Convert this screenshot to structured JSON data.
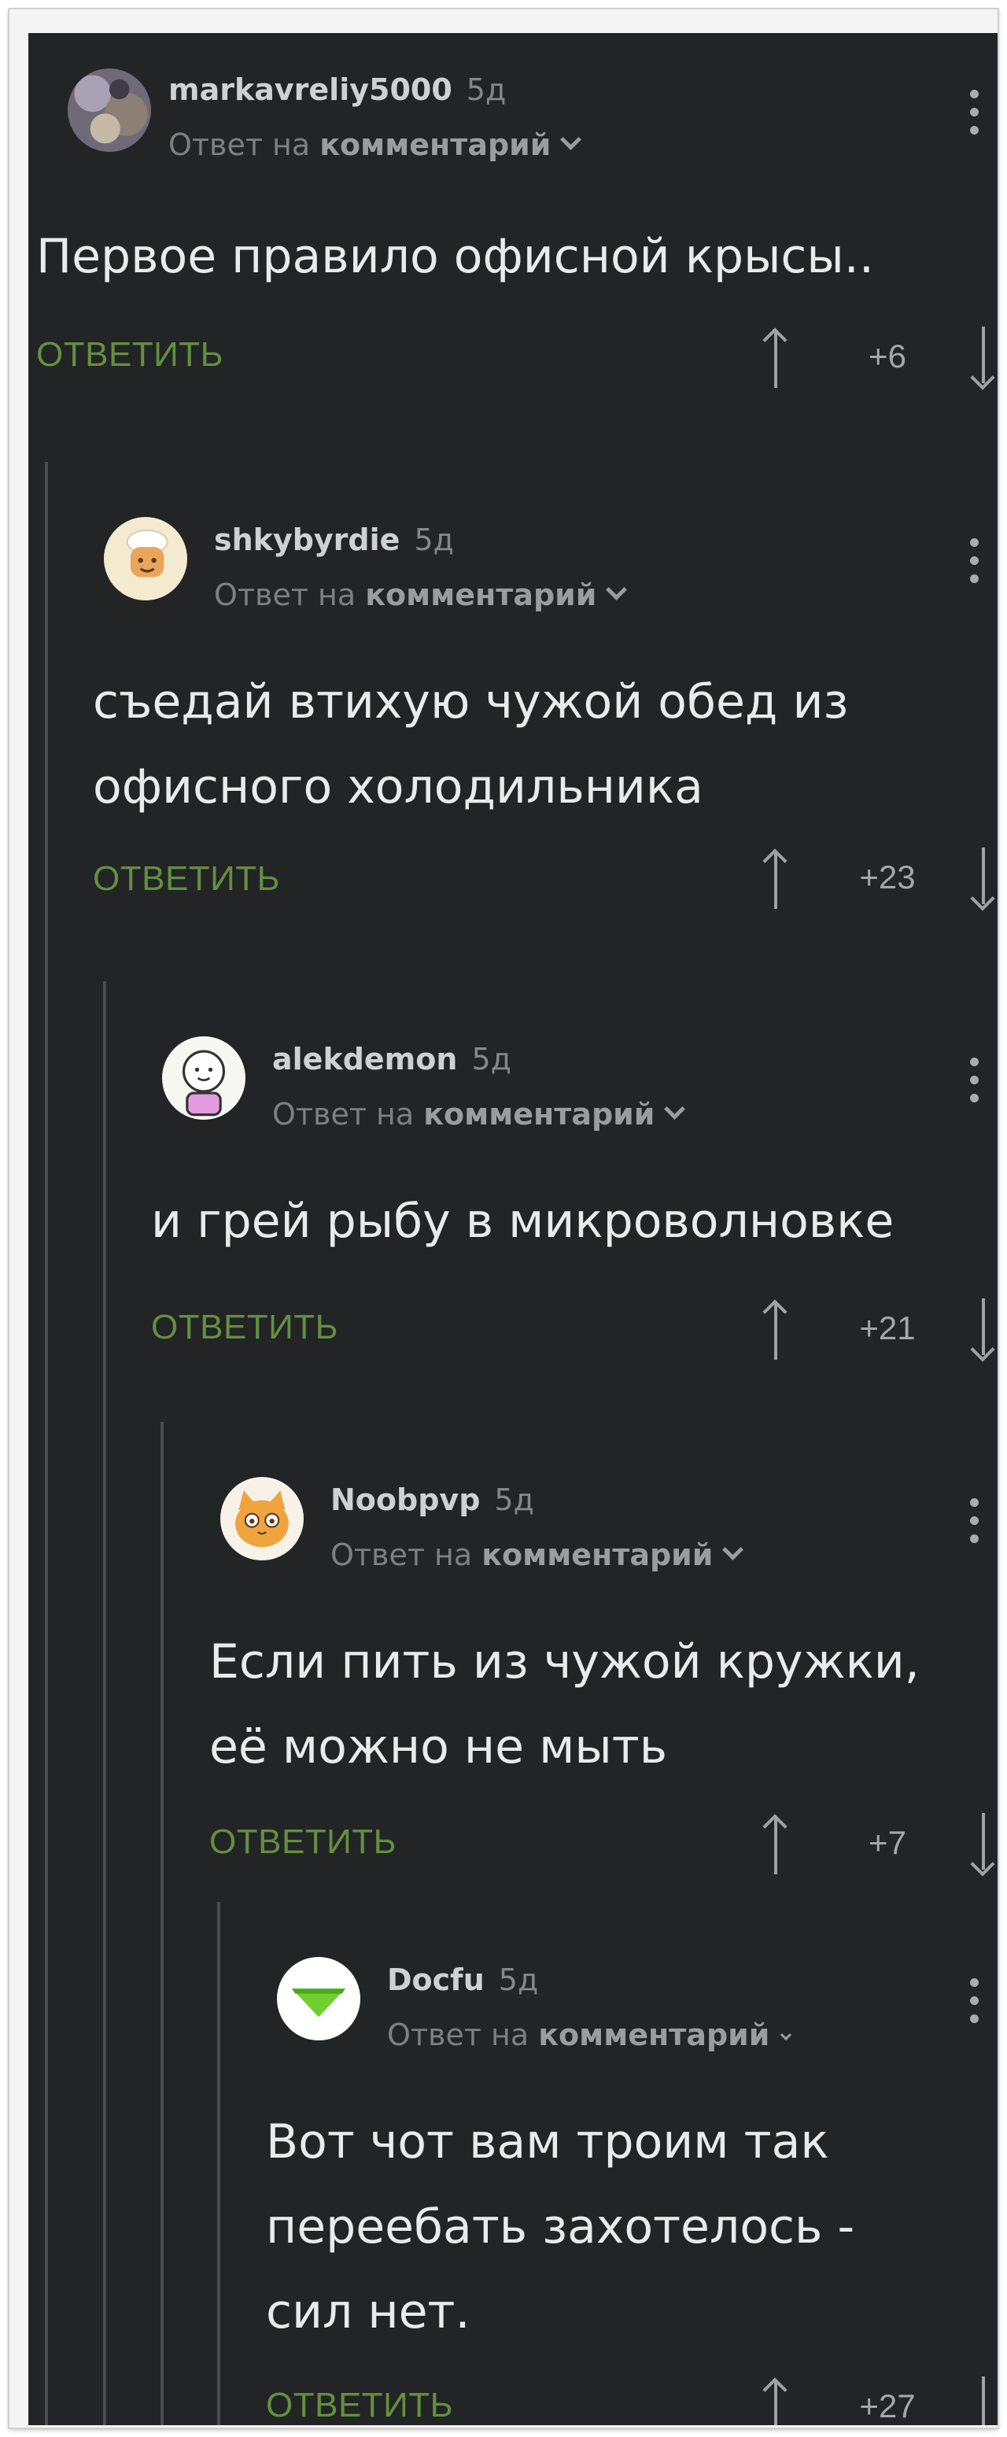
{
  "comments": [
    {
      "user": "markavreliy5000",
      "age": "5д",
      "reply_to_prefix": "Ответ на",
      "reply_to_target": "комментарий",
      "lines": [
        "Первое правило офисной крысы.."
      ],
      "reply_label": "ОТВЕТИТЬ",
      "score": "+6"
    },
    {
      "user": "shkybyrdie",
      "age": "5д",
      "reply_to_prefix": "Ответ на",
      "reply_to_target": "комментарий",
      "lines": [
        "съедай втихую чужой обед из",
        "офисного холодильника"
      ],
      "reply_label": "ОТВЕТИТЬ",
      "score": "+23"
    },
    {
      "user": "alekdemon",
      "age": "5д",
      "reply_to_prefix": "Ответ на",
      "reply_to_target": "комментарий",
      "lines": [
        "и грей рыбу в микроволновке"
      ],
      "reply_label": "ОТВЕТИТЬ",
      "score": "+21"
    },
    {
      "user": "Noobpvp",
      "age": "5д",
      "reply_to_prefix": "Ответ на",
      "reply_to_target": "комментарий",
      "lines": [
        "Если пить из чужой кружки,",
        "её можно не мыть"
      ],
      "reply_label": "ОТВЕТИТЬ",
      "score": "+7"
    },
    {
      "user": "Docfu",
      "age": "5д",
      "reply_to_prefix": "Ответ на",
      "reply_to_target": "комментарий",
      "lines": [
        "Вот чот вам троим так",
        "переебать захотелось -",
        "сил нет."
      ],
      "reply_label": "ОТВЕТИТЬ",
      "score": "+27"
    }
  ],
  "icons": {
    "more": "more-vertical-icon",
    "upvote": "arrow-up-icon",
    "downvote": "arrow-down-icon",
    "expand": "chevron-down-icon"
  },
  "colors": {
    "background": "#222426",
    "reply_accent": "#62903f",
    "thread_line": "#4b4d51"
  }
}
